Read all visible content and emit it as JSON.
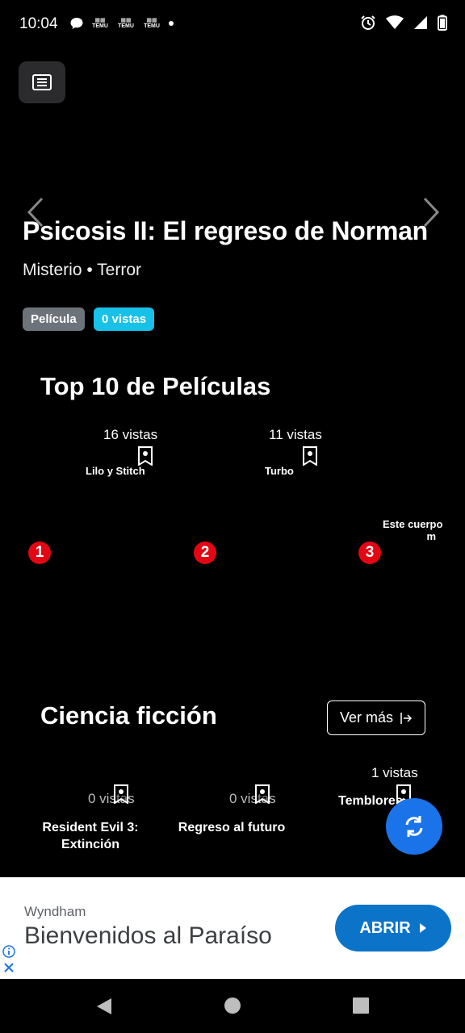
{
  "status_bar": {
    "time": "10:04",
    "left_icons": [
      "chat-bubble-icon",
      "temu-icon",
      "temu-icon",
      "temu-icon",
      "dot-icon"
    ],
    "temu_label": "TEMU",
    "right_icons": [
      "alarm-icon",
      "wifi-icon",
      "signal-icon",
      "battery-icon"
    ]
  },
  "menu": {
    "icon": "list-icon"
  },
  "hero": {
    "title": "Psicosis II: El regreso de Norman",
    "genres": "Misterio • Terror",
    "badge_type": "Película",
    "badge_views": "0 vistas",
    "prev_icon": "chevron-left-icon",
    "next_icon": "chevron-right-icon"
  },
  "top10": {
    "title": "Top 10 de Películas",
    "items": [
      {
        "rank": "1",
        "views": "16 vistas",
        "name": "Lilo y Stitch"
      },
      {
        "rank": "2",
        "views": "11 vistas",
        "name": "Turbo"
      },
      {
        "rank": "3",
        "views": "",
        "name": "Este cuerpo",
        "name2": "m"
      }
    ]
  },
  "scifi": {
    "title": "Ciencia ficción",
    "see_more": "Ver más",
    "items": [
      {
        "views": "0 vistas",
        "name": "Resident Evil 3: Extinción"
      },
      {
        "views": "0 vistas",
        "name": "Regreso al futuro"
      },
      {
        "views": "1 vistas",
        "name": "Temblores"
      }
    ]
  },
  "fab": {
    "icon": "refresh-icon"
  },
  "ad": {
    "brand": "Wyndham",
    "headline": "Bienvenidos al Paraíso",
    "cta": "ABRIR"
  },
  "colors": {
    "background": "#000000",
    "badge_type": "#6d737a",
    "badge_views": "#17c1e8",
    "rank": "#e30613",
    "fab": "#1a73e8",
    "ad_cta": "#0b74c9"
  }
}
